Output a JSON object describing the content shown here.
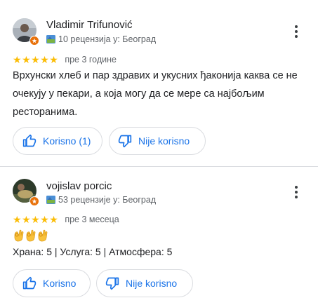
{
  "reviews": [
    {
      "author": "Vladimir Trifunović",
      "meta": "10 рецензија у: Београд",
      "rating": 5,
      "time": "пре 3 године",
      "text": "Врхунски хлеб и пар здравих и укусних ђаконија каква се не очекују у пекари, а која могу да се мере са најбољим ресторанима.",
      "helpful_label": "Korisno (1)",
      "not_helpful_label": "Nije korisno"
    },
    {
      "author": "vojislav porcic",
      "meta": "53 рецензије у: Београд",
      "rating": 5,
      "time": "пре 3 месеца",
      "emoji": [
        "ok-hand-icon",
        "ok-hand-icon",
        "ok-hand-icon"
      ],
      "subratings": "Храна: 5 | Услуга: 5 | Атмосфера: 5",
      "helpful_label": "Korisno",
      "not_helpful_label": "Nije korisno"
    }
  ],
  "colors": {
    "accent": "#1a73e8",
    "star": "#fbbc04",
    "guide_badge": "#e8710a",
    "divider": "#dadce0"
  },
  "icons": {
    "more": "more-vert-icon",
    "helpful": "thumb-up-icon",
    "not_helpful": "thumb-down-icon",
    "meta": "local-guide-map-icon"
  }
}
